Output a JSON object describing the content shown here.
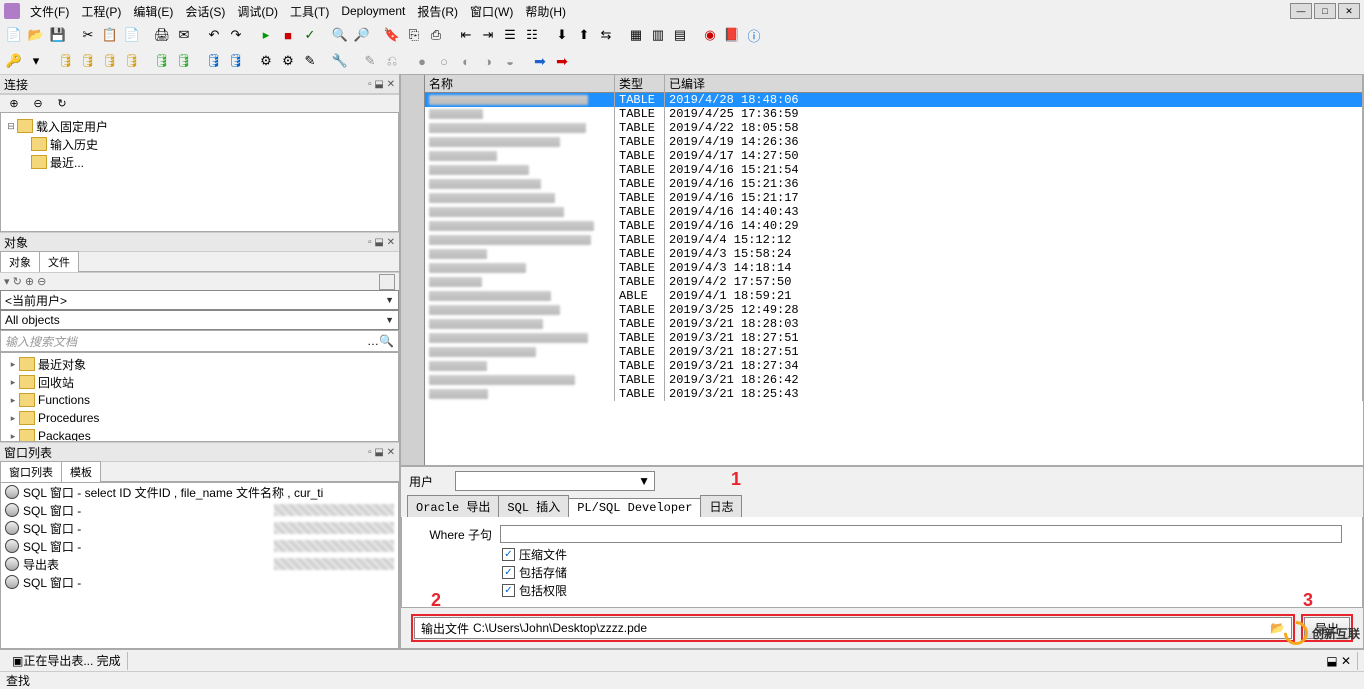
{
  "menu": {
    "items": [
      "文件(F)",
      "工程(P)",
      "编辑(E)",
      "会话(S)",
      "调试(D)",
      "工具(T)",
      "Deployment",
      "报告(R)",
      "窗口(W)",
      "帮助(H)"
    ]
  },
  "panels": {
    "connect": "连接",
    "objects": "对象",
    "tabs1": [
      "对象",
      "文件"
    ],
    "current_user": "<当前用户>",
    "all_objects": "All objects",
    "search_ph": "输入搜索文档",
    "winlist": "窗口列表",
    "tabs2": [
      "窗口列表",
      "模板"
    ]
  },
  "conn_tree": [
    "载入固定用户",
    "输入历史",
    "最近..."
  ],
  "obj_tree": [
    "最近对象",
    "回收站",
    "Functions",
    "Procedures",
    "Packages"
  ],
  "winlist": [
    "SQL 窗口 - select ID 文件ID , file_name 文件名称 , cur_ti",
    "SQL 窗口 - ",
    "SQL 窗口 - ",
    "SQL 窗口 - ",
    "导出表",
    "SQL 窗口 - "
  ],
  "grid": {
    "headers": [
      "名称",
      "类型",
      "已编译"
    ],
    "rows": [
      [
        "TABLE",
        "2019/4/28 18:48:06"
      ],
      [
        "TABLE",
        "2019/4/25 17:36:59"
      ],
      [
        "TABLE",
        "2019/4/22 18:05:58"
      ],
      [
        "TABLE",
        "2019/4/19 14:26:36"
      ],
      [
        "TABLE",
        "2019/4/17 14:27:50"
      ],
      [
        "TABLE",
        "2019/4/16 15:21:54"
      ],
      [
        "TABLE",
        "2019/4/16 15:21:36"
      ],
      [
        "TABLE",
        "2019/4/16 15:21:17"
      ],
      [
        "TABLE",
        "2019/4/16 14:40:43"
      ],
      [
        "TABLE",
        "2019/4/16 14:40:29"
      ],
      [
        "TABLE",
        "2019/4/4 15:12:12"
      ],
      [
        "TABLE",
        "2019/4/3 15:58:24"
      ],
      [
        "TABLE",
        "2019/4/3 14:18:14"
      ],
      [
        "TABLE",
        "2019/4/2 17:57:50"
      ],
      [
        "ABLE",
        "2019/4/1 18:59:21"
      ],
      [
        "TABLE",
        "2019/3/25 12:49:28"
      ],
      [
        "TABLE",
        "2019/3/21 18:28:03"
      ],
      [
        "TABLE",
        "2019/3/21 18:27:51"
      ],
      [
        "TABLE",
        "2019/3/21 18:27:51"
      ],
      [
        "TABLE",
        "2019/3/21 18:27:34"
      ],
      [
        "TABLE",
        "2019/3/21 18:26:42"
      ],
      [
        "TABLE",
        "2019/3/21 18:25:43"
      ]
    ]
  },
  "form": {
    "user_lbl": "用户",
    "tabs": [
      "Oracle 导出",
      "SQL 插入",
      "PL/SQL Developer",
      "日志"
    ],
    "where_lbl": "Where 子句",
    "chk1": "压缩文件",
    "chk2": "包括存储",
    "chk3": "包括权限",
    "out_lbl": "输出文件",
    "out_path": "C:\\Users\\John\\Desktop\\zzzz.pde",
    "btn": "导出",
    "num1": "1",
    "num2": "2",
    "num3": "3"
  },
  "status": {
    "left": "查找",
    "mid": "正在导出表...  完成"
  },
  "watermark": "创新互联"
}
